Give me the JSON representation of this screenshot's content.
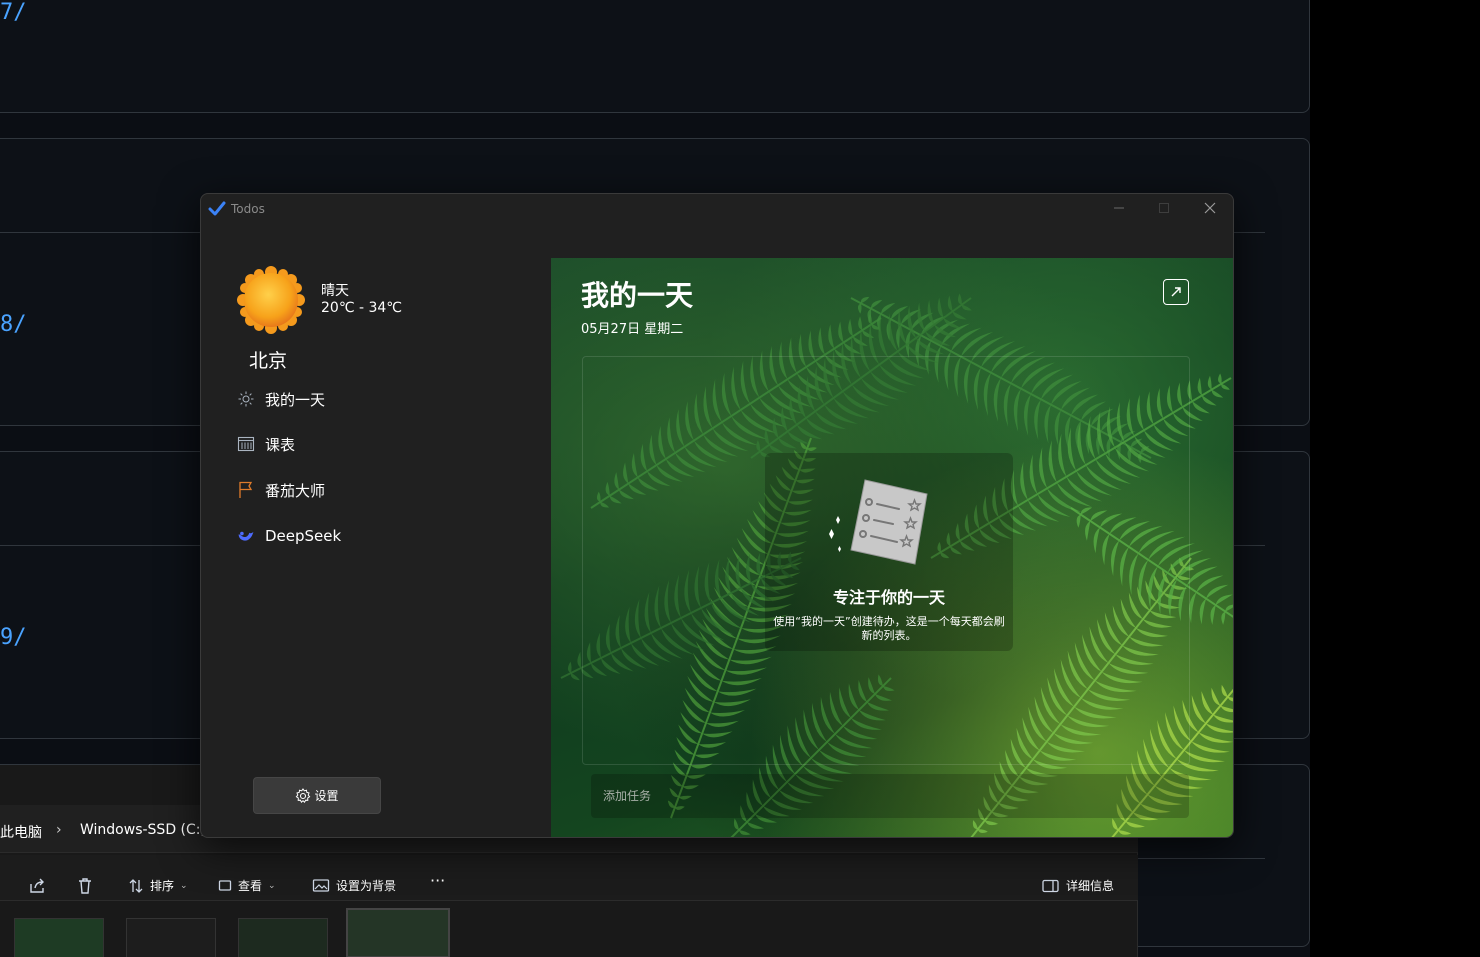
{
  "background_page": {
    "links": [
      "7/",
      "8/",
      "9/"
    ]
  },
  "explorer": {
    "breadcrumb": [
      "此电脑",
      "Windows-SSD (C:)"
    ],
    "toolbar": {
      "sort_label": "排序",
      "view_label": "查看",
      "set_bg_label": "设置为背景",
      "more_label": "···",
      "details_label": "详细信息"
    }
  },
  "todos": {
    "app_title": "Todos",
    "weather": {
      "condition": "晴天",
      "temp_range": "20℃ - 34℃",
      "city": "北京"
    },
    "nav": [
      {
        "label": "我的一天",
        "icon": "sun-icon"
      },
      {
        "label": "课表",
        "icon": "calendar-icon"
      },
      {
        "label": "番茄大师",
        "icon": "flag-icon"
      },
      {
        "label": "DeepSeek",
        "icon": "whale-icon"
      }
    ],
    "settings_label": "设置",
    "main": {
      "title": "我的一天",
      "date": "05月27日 星期二",
      "empty_title": "专注于你的一天",
      "empty_desc": "使用“我的一天”创建待办，这是一个每天都会刷新的列表。",
      "add_task_placeholder": "添加任务"
    }
  },
  "colors": {
    "accent": "#4aa3ff",
    "window_bg": "#202020",
    "flag": "#e07b2a"
  }
}
